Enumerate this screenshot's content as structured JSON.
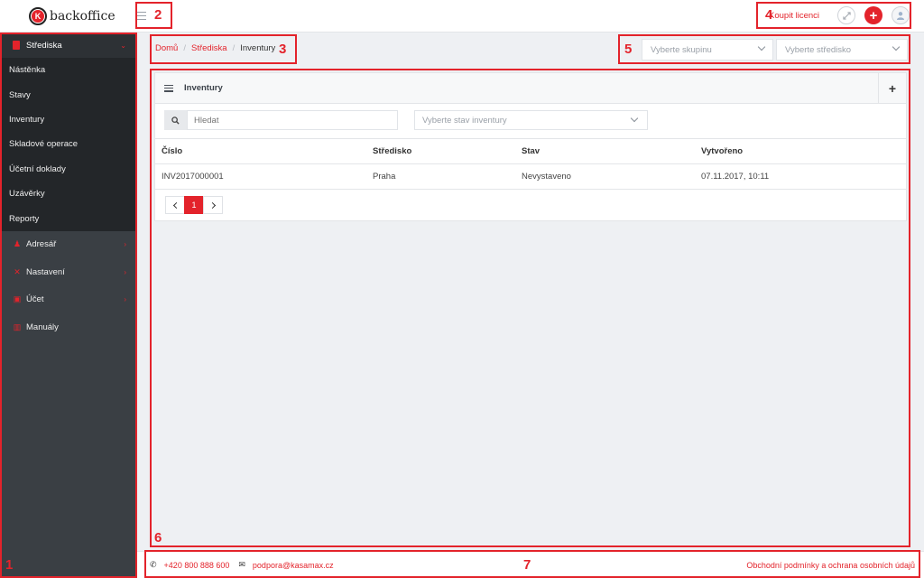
{
  "app": {
    "logo_letter": "K",
    "logo_text": "backoffice"
  },
  "header": {
    "buy_license": "Koupit licenci",
    "add_symbol": "+",
    "accent_color": "#e3232b"
  },
  "sidebar": {
    "section": {
      "label": "Střediska",
      "icon": "building-icon"
    },
    "subitems": [
      "Nástěnka",
      "Stavy",
      "Inventury",
      "Skladové operace",
      "Účetní doklady",
      "Uzávěrky",
      "Reporty"
    ],
    "items": [
      {
        "label": "Adresář",
        "icon": "users-icon"
      },
      {
        "label": "Nastavení",
        "icon": "tools-icon"
      },
      {
        "label": "Účet",
        "icon": "lock-icon"
      },
      {
        "label": "Manuály",
        "icon": "book-icon"
      }
    ]
  },
  "breadcrumb": {
    "home": "Domů",
    "section": "Střediska",
    "current": "Inventury",
    "separator": "/"
  },
  "selects": {
    "group_placeholder": "Vyberte skupinu",
    "center_placeholder": "Vyberte středisko"
  },
  "panel": {
    "title": "Inventury",
    "add_symbol": "+",
    "search_placeholder": "Hledat",
    "state_placeholder": "Vyberte stav inventury",
    "columns": [
      "Číslo",
      "Středisko",
      "Stav",
      "Vytvořeno"
    ],
    "rows": [
      [
        "INV2017000001",
        "Praha",
        "Nevystaveno",
        "07.11.2017, 10:11"
      ]
    ],
    "current_page": "1"
  },
  "footer": {
    "phone": "+420 800 888 600",
    "email": "podpora@kasamax.cz",
    "terms": "Obchodní podmínky a ochrana osobních údajů"
  },
  "annotations": [
    "1",
    "2",
    "3",
    "4",
    "5",
    "6",
    "7"
  ]
}
